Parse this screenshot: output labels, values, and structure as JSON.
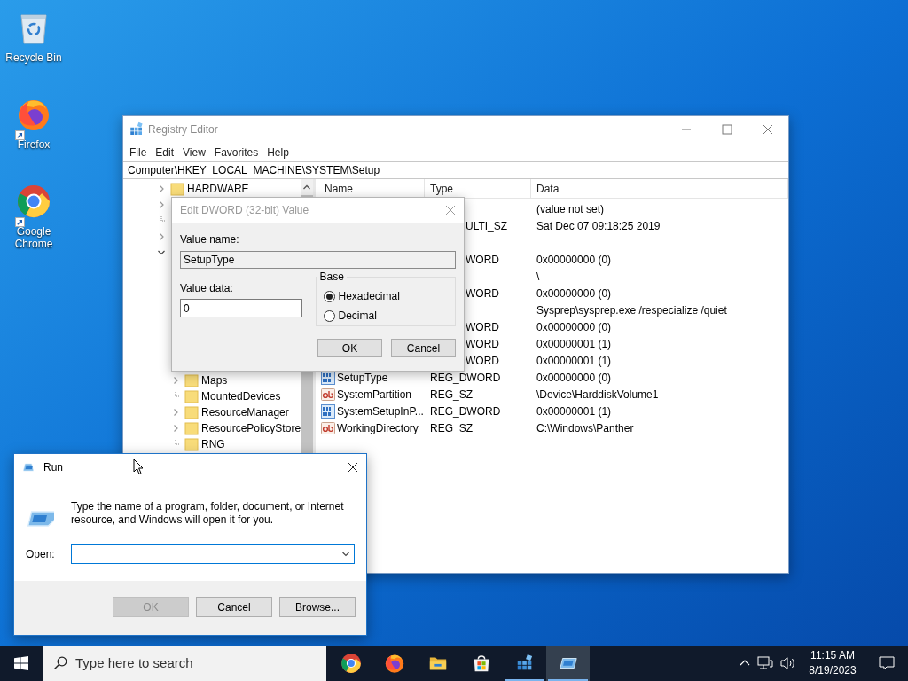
{
  "desktop_icons": [
    {
      "label": "Recycle Bin",
      "kind": "recycle",
      "shortcut": false
    },
    {
      "label": "Firefox",
      "kind": "firefox",
      "shortcut": true
    },
    {
      "label": "Google Chrome",
      "kind": "chrome",
      "shortcut": true
    }
  ],
  "registry_editor": {
    "title": "Registry Editor",
    "menu": [
      "File",
      "Edit",
      "View",
      "Favorites",
      "Help"
    ],
    "address": "Computer\\HKEY_LOCAL_MACHINE\\SYSTEM\\Setup",
    "tree": [
      {
        "label": "HARDWARE",
        "expandable": true,
        "expanded": false
      },
      {
        "expandable": true,
        "expanded": false
      },
      {
        "expandable": false
      },
      {
        "expandable": true,
        "expanded": false
      },
      {
        "expandable": true,
        "expanded": true,
        "children": [
          {
            "label": "Maps",
            "expandable": true,
            "expanded": false
          },
          {
            "label": "MountedDevices",
            "expandable": false
          },
          {
            "label": "ResourceManager",
            "expandable": true,
            "expanded": false
          },
          {
            "label": "ResourcePolicyStore",
            "expandable": true,
            "expanded": false
          },
          {
            "label": "RNG",
            "expandable": false
          }
        ]
      }
    ],
    "columns": [
      "Name",
      "Type",
      "Data"
    ],
    "rows": [
      {
        "data": "(value not set)"
      },
      {
        "type": "ULTI_SZ",
        "data": "Sat Dec 07 09:18:25 2019"
      },
      {},
      {
        "type": "WORD",
        "data": "0x00000000 (0)"
      },
      {
        "data": "\\"
      },
      {
        "type": "WORD",
        "data": "0x00000000 (0)"
      },
      {
        "data": "Sysprep\\sysprep.exe /respecialize /quiet"
      },
      {
        "type": "WORD",
        "data": "0x00000000 (0)"
      },
      {
        "type": "WORD",
        "data": "0x00000001 (1)"
      },
      {
        "type": "WORD",
        "data": "0x00000001 (1)"
      },
      {
        "kind": "dword",
        "name": "SetupType",
        "type": "REG_DWORD",
        "data": "0x00000000 (0)"
      },
      {
        "kind": "string",
        "name": "SystemPartition",
        "type": "REG_SZ",
        "data": "\\Device\\HarddiskVolume1"
      },
      {
        "kind": "dword",
        "name": "SystemSetupInP...",
        "type": "REG_DWORD",
        "data": "0x00000001 (1)"
      },
      {
        "kind": "string",
        "name": "WorkingDirectory",
        "type": "REG_SZ",
        "data": "C:\\Windows\\Panther"
      }
    ]
  },
  "edit_dword_dialog": {
    "title": "Edit DWORD (32-bit) Value",
    "value_name_label": "Value name:",
    "value_name": "SetupType",
    "value_data_label": "Value data:",
    "value_data": "0",
    "base_label": "Base",
    "radios": [
      {
        "label": "Hexadecimal",
        "selected": true
      },
      {
        "label": "Decimal",
        "selected": false
      }
    ],
    "buttons": [
      "OK",
      "Cancel"
    ]
  },
  "run_dialog": {
    "title": "Run",
    "message": "Type the name of a program, folder, document, or Internet resource, and Windows will open it for you.",
    "open_label": "Open:",
    "buttons": [
      {
        "label": "OK",
        "disabled": true
      },
      {
        "label": "Cancel",
        "disabled": false
      },
      {
        "label": "Browse...",
        "disabled": false
      }
    ]
  },
  "taskbar": {
    "search_placeholder": "Type here to search",
    "apps": [
      {
        "kind": "chrome",
        "running": false,
        "selected": false
      },
      {
        "kind": "firefox",
        "running": false,
        "selected": false
      },
      {
        "kind": "explorer",
        "running": false,
        "selected": false
      },
      {
        "kind": "store",
        "running": false,
        "selected": false
      },
      {
        "kind": "regedit",
        "running": true,
        "selected": false
      },
      {
        "kind": "run",
        "running": true,
        "selected": true
      }
    ],
    "time": "11:15 AM",
    "date": "8/19/2023"
  }
}
